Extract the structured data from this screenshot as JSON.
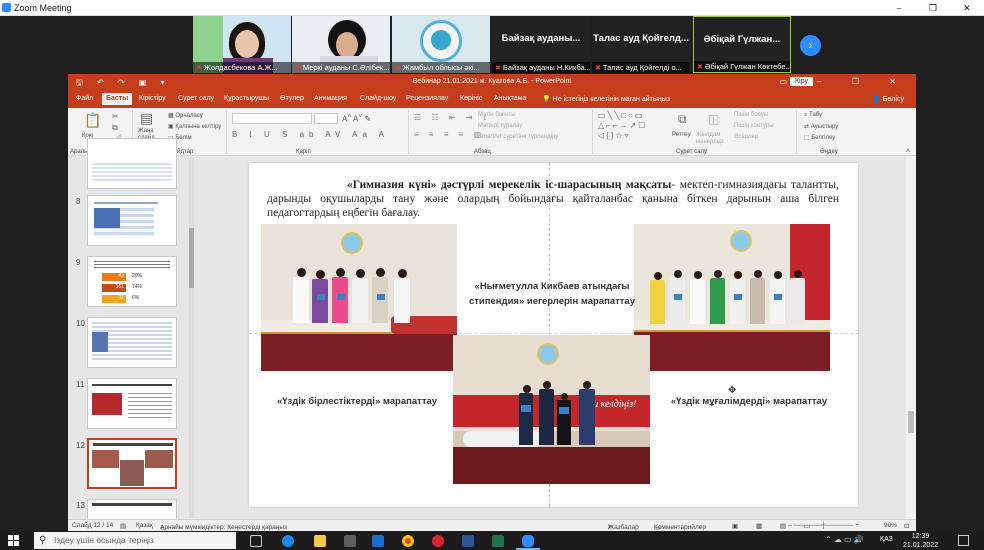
{
  "zoom": {
    "title": "Zoom Meeting",
    "window_controls": [
      "–",
      "❐",
      "✕"
    ],
    "participants": [
      {
        "name": "Жолдасбекова А.Ж...",
        "muted": true
      },
      {
        "name": "Меркі ауданы С.Әлібек...",
        "muted": true
      },
      {
        "name": "Жамбыл облысы әкі...",
        "muted": true
      },
      {
        "big_name": "Байзақ ауданы...",
        "name": "Байзақ ауданы Н.Кикба...",
        "muted": true
      },
      {
        "big_name": "Талас ауд Қойгелд...",
        "name": "Талас ауд Қойгелді о...",
        "muted": true
      },
      {
        "big_name": "Әбіқай Гүлжан...",
        "name": "Әбіқай Гүлжан Көктебе...",
        "muted": true
      }
    ],
    "next_icon": "›"
  },
  "powerpoint": {
    "title": "Вебинар 21.01.2021 ж. Куатова А.Б.  -  PowerPoint",
    "login": "Кіру",
    "quick_access": "🖫 ↶ ↷ ▣ ▾",
    "window_controls": "▭ – ❐ ✕",
    "tabs": [
      "Файл",
      "Басты",
      "Кірістіру",
      "Сурет салу",
      "Құрастырушы",
      "Өтулер",
      "Анимация",
      "Слайд-шоу",
      "Рецензиялау",
      "Көрініс",
      "Анықтама"
    ],
    "tell_me": "Не істегіңіз келетінін маған айтыңыз",
    "share": "Бөлісу",
    "ribbon": {
      "paste": "Қою",
      "new_slide": "Жаңа слайд",
      "layout": "Орналасу",
      "reset": "Қалпына келтіру",
      "section": "Бөлім",
      "text_direction": "Мәтін бағыты",
      "align_text": "Мәтінді туралау",
      "smartart": "SmartArt суретіне түрлендіру",
      "arrange": "Реттеу",
      "quick_styles": "Жылдам мәнерлер",
      "shape_fill": "Пішін бояуы",
      "shape_outline": "Пішін контуры",
      "effects": "Әсерлер",
      "find": "Табу",
      "replace": "Ауыстыру",
      "select": "Белгілеу",
      "groups": {
        "clipboard": "Аралық сақтағыш",
        "slides": "Слайдтар",
        "font": "Қаріп",
        "paragraph": "Абзац",
        "drawing": "Сурет салу",
        "editing": "Өңдеу"
      }
    },
    "thumbnails": [
      {
        "num": "8"
      },
      {
        "num": "9",
        "values": [
          "43",
          "161",
          "11"
        ],
        "pcts": [
          "20%",
          "74%",
          "6%"
        ]
      },
      {
        "num": "10"
      },
      {
        "num": "11"
      },
      {
        "num": "12",
        "selected": true
      },
      {
        "num": "13"
      }
    ],
    "status": {
      "slide": "Слайд 12 / 14",
      "language": "Қазақ",
      "accessibility": "Арнайы мүмкіндіктер: Кеңестерді қараңыз",
      "notes": "Жазбалар",
      "comments": "Комментарийлер",
      "zoom": "90%"
    }
  },
  "slide": {
    "heading_bold": "«Гимназия күні» дәстүрлі мерекелік іс-шарасының мақсаты",
    "heading_rest": "- мектеп-гимназиядағы талантты, дарынды оқушыларды тану және олардың бойындағы қайталанбас қанына біткен дарынын аша білген педагогтардың еңбегін бағалау.",
    "center_caption": "«Нығметулла Кикбаев атындағы стипендия» иегерлерін марапаттау",
    "left_caption": "«Үздік бірлестіктерді» марапаттау",
    "right_caption": "«Үздік мұғалімдерді» марапаттау",
    "banner_text": "Қош келдіңіз!"
  },
  "taskbar": {
    "search_placeholder": "Іздеу үшін осында теріңіз",
    "language": "ҚАЗ",
    "time": "12:39",
    "date": "21.01.2022",
    "tray": "⌃ ☁ ▭ 🔊"
  }
}
